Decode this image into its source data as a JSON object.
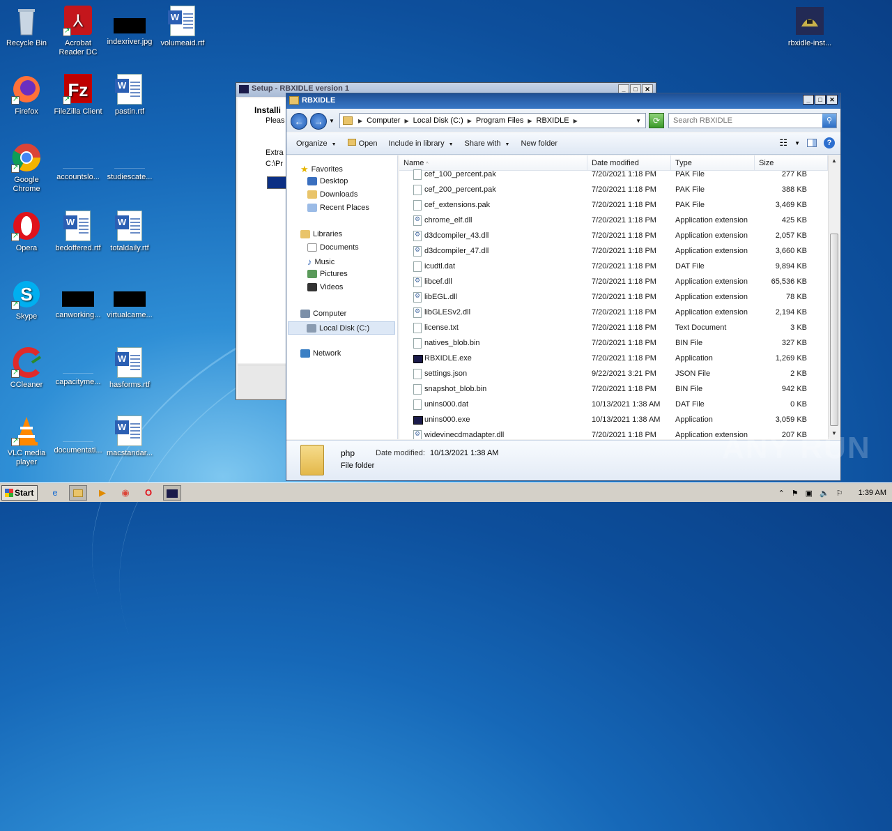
{
  "desktop": {
    "icons": [
      {
        "label": "Recycle Bin"
      },
      {
        "label": "Acrobat Reader DC"
      },
      {
        "label": "indexriver.jpg"
      },
      {
        "label": "volumeaid.rtf"
      },
      {
        "label": "Firefox"
      },
      {
        "label": "FileZilla Client"
      },
      {
        "label": "pastin.rtf"
      },
      {
        "label": "Google Chrome"
      },
      {
        "label": "accountslo..."
      },
      {
        "label": "studiescate..."
      },
      {
        "label": "Opera"
      },
      {
        "label": "bedoffered.rtf"
      },
      {
        "label": "totaldaily.rtf"
      },
      {
        "label": "Skype"
      },
      {
        "label": "canworking..."
      },
      {
        "label": "virtualcame..."
      },
      {
        "label": "CCleaner"
      },
      {
        "label": "capacityme..."
      },
      {
        "label": "hasforms.rtf"
      },
      {
        "label": "VLC media player"
      },
      {
        "label": "documentati..."
      },
      {
        "label": "macstandar..."
      },
      {
        "label": "rbxidle-inst..."
      }
    ]
  },
  "setup_window": {
    "title": "Setup - RBXIDLE version 1",
    "installing": "Installi",
    "please": "Pleas",
    "extract": "Extra",
    "path": "C:\\Pr"
  },
  "explorer": {
    "title": "RBXIDLE",
    "breadcrumb": [
      "Computer",
      "Local Disk (C:)",
      "Program Files",
      "RBXIDLE"
    ],
    "search_placeholder": "Search RBXIDLE",
    "toolbar": {
      "organize": "Organize",
      "open": "Open",
      "include": "Include in library",
      "share": "Share with",
      "new_folder": "New folder"
    },
    "nav": {
      "favorites": "Favorites",
      "desktop": "Desktop",
      "downloads": "Downloads",
      "recent": "Recent Places",
      "libraries": "Libraries",
      "documents": "Documents",
      "music": "Music",
      "pictures": "Pictures",
      "videos": "Videos",
      "computer": "Computer",
      "local_disk": "Local Disk (C:)",
      "network": "Network"
    },
    "columns": {
      "name": "Name",
      "date": "Date modified",
      "type": "Type",
      "size": "Size"
    },
    "files": [
      {
        "name": "cef_100_percent.pak",
        "date": "7/20/2021 1:18 PM",
        "type": "PAK File",
        "size": "277 KB",
        "kind": "file"
      },
      {
        "name": "cef_200_percent.pak",
        "date": "7/20/2021 1:18 PM",
        "type": "PAK File",
        "size": "388 KB",
        "kind": "file"
      },
      {
        "name": "cef_extensions.pak",
        "date": "7/20/2021 1:18 PM",
        "type": "PAK File",
        "size": "3,469 KB",
        "kind": "file"
      },
      {
        "name": "chrome_elf.dll",
        "date": "7/20/2021 1:18 PM",
        "type": "Application extension",
        "size": "425 KB",
        "kind": "dll"
      },
      {
        "name": "d3dcompiler_43.dll",
        "date": "7/20/2021 1:18 PM",
        "type": "Application extension",
        "size": "2,057 KB",
        "kind": "dll"
      },
      {
        "name": "d3dcompiler_47.dll",
        "date": "7/20/2021 1:18 PM",
        "type": "Application extension",
        "size": "3,660 KB",
        "kind": "dll"
      },
      {
        "name": "icudtl.dat",
        "date": "7/20/2021 1:18 PM",
        "type": "DAT File",
        "size": "9,894 KB",
        "kind": "file"
      },
      {
        "name": "libcef.dll",
        "date": "7/20/2021 1:18 PM",
        "type": "Application extension",
        "size": "65,536 KB",
        "kind": "dll"
      },
      {
        "name": "libEGL.dll",
        "date": "7/20/2021 1:18 PM",
        "type": "Application extension",
        "size": "78 KB",
        "kind": "dll"
      },
      {
        "name": "libGLESv2.dll",
        "date": "7/20/2021 1:18 PM",
        "type": "Application extension",
        "size": "2,194 KB",
        "kind": "dll"
      },
      {
        "name": "license.txt",
        "date": "7/20/2021 1:18 PM",
        "type": "Text Document",
        "size": "3 KB",
        "kind": "file"
      },
      {
        "name": "natives_blob.bin",
        "date": "7/20/2021 1:18 PM",
        "type": "BIN File",
        "size": "327 KB",
        "kind": "file"
      },
      {
        "name": "RBXIDLE.exe",
        "date": "7/20/2021 1:18 PM",
        "type": "Application",
        "size": "1,269 KB",
        "kind": "exe"
      },
      {
        "name": "settings.json",
        "date": "9/22/2021 3:21 PM",
        "type": "JSON File",
        "size": "2 KB",
        "kind": "file"
      },
      {
        "name": "snapshot_blob.bin",
        "date": "7/20/2021 1:18 PM",
        "type": "BIN File",
        "size": "942 KB",
        "kind": "file"
      },
      {
        "name": "unins000.dat",
        "date": "10/13/2021 1:38 AM",
        "type": "DAT File",
        "size": "0 KB",
        "kind": "file"
      },
      {
        "name": "unins000.exe",
        "date": "10/13/2021 1:38 AM",
        "type": "Application",
        "size": "3,059 KB",
        "kind": "exe"
      },
      {
        "name": "widevinecdmadapter.dll",
        "date": "7/20/2021 1:18 PM",
        "type": "Application extension",
        "size": "207 KB",
        "kind": "dll"
      }
    ],
    "details": {
      "name": "php",
      "modified_label": "Date modified:",
      "modified": "10/13/2021 1:38 AM",
      "type": "File folder"
    }
  },
  "watermark": "ANY RUN",
  "taskbar": {
    "start": "Start",
    "clock": "1:39 AM"
  }
}
